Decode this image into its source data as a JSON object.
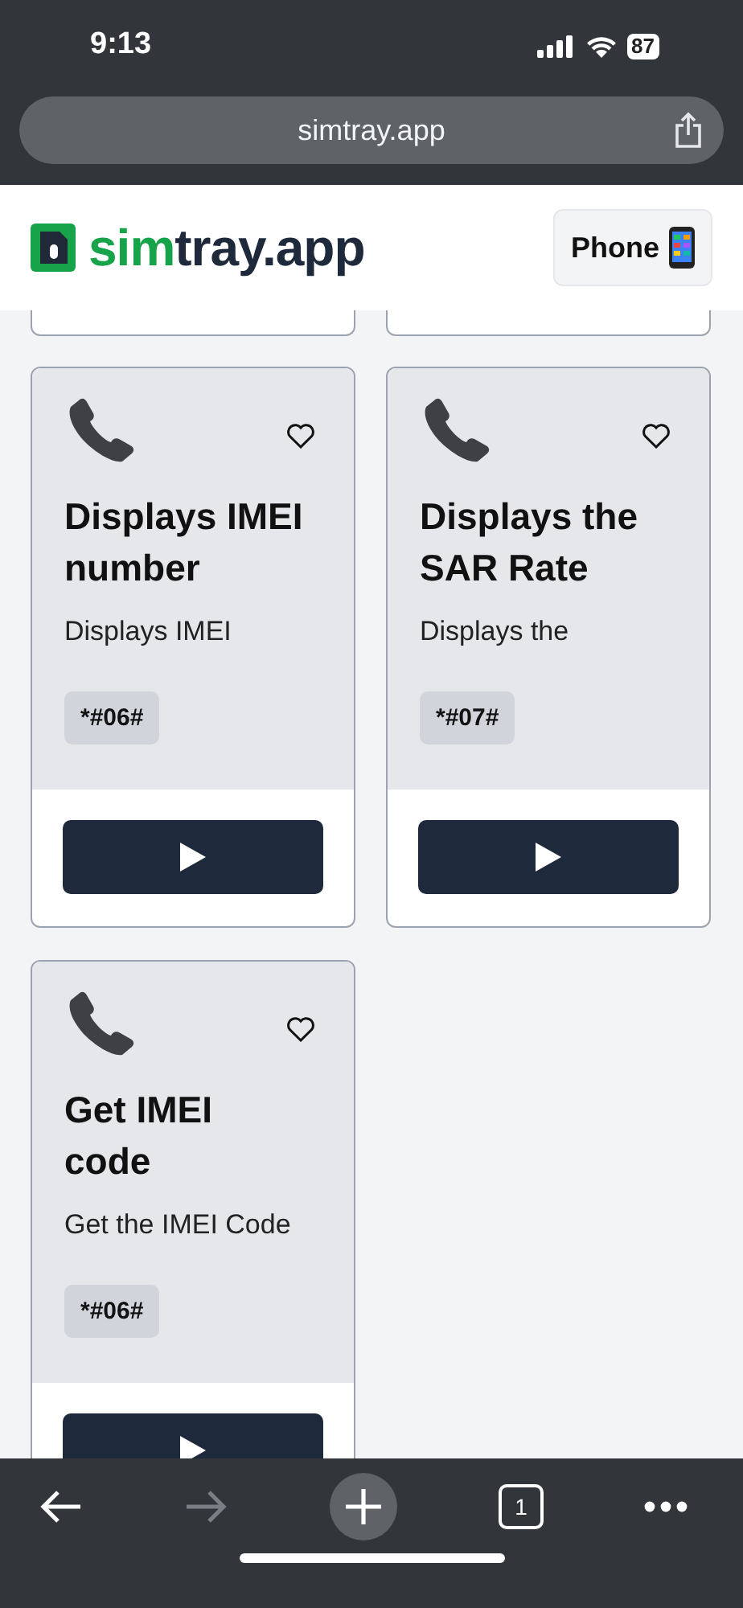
{
  "status_bar": {
    "time": "9:13",
    "battery": "87"
  },
  "address_bar": {
    "url": "simtray.app"
  },
  "header": {
    "brand": {
      "accent": "sim",
      "rest": "tray.app"
    },
    "device_button": "Phone"
  },
  "cards": [
    {
      "title": "Displays IMEI number",
      "description": "Displays IMEI",
      "code": "*#06#",
      "favorite": false
    },
    {
      "title": "Displays the SAR Rate",
      "description": "Displays the",
      "code": "*#07#",
      "favorite": false
    },
    {
      "title": "Get IMEI code",
      "description": "Get the IMEI Code",
      "code": "*#06#",
      "favorite": false
    }
  ],
  "toolbar": [
    {
      "kind": "back",
      "disabled": false
    },
    {
      "kind": "forward",
      "disabled": true
    },
    {
      "kind": "new-tab",
      "disabled": false
    },
    {
      "kind": "tabs",
      "label": "1",
      "disabled": false
    },
    {
      "kind": "more",
      "disabled": false
    }
  ]
}
